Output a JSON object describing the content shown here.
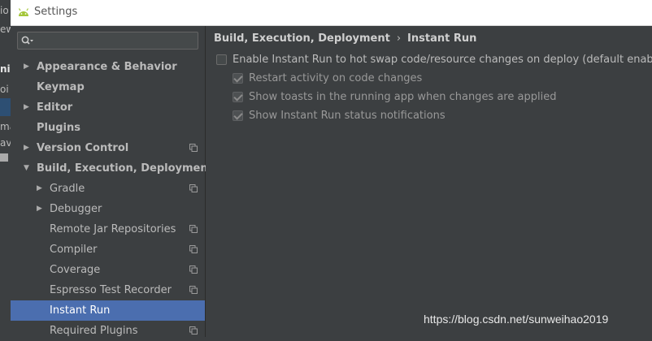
{
  "background_fragments": [
    "io",
    "ew",
    "ni",
    "oi",
    "ma",
    "av"
  ],
  "window": {
    "title": "Settings"
  },
  "sidebar": {
    "search_placeholder": "",
    "items": [
      {
        "label": "Appearance & Behavior",
        "arrow": "right",
        "bold": true
      },
      {
        "label": "Keymap",
        "arrow": "",
        "bold": true
      },
      {
        "label": "Editor",
        "arrow": "right",
        "bold": true
      },
      {
        "label": "Plugins",
        "arrow": "",
        "bold": true
      },
      {
        "label": "Version Control",
        "arrow": "right",
        "bold": true,
        "copy_icon": true
      },
      {
        "label": "Build, Execution, Deployment",
        "arrow": "down",
        "bold": true
      },
      {
        "label": "Gradle",
        "arrow": "right",
        "copy_icon": true
      },
      {
        "label": "Debugger",
        "arrow": "right"
      },
      {
        "label": "Remote Jar Repositories",
        "copy_icon": true
      },
      {
        "label": "Compiler",
        "copy_icon": true
      },
      {
        "label": "Coverage",
        "copy_icon": true
      },
      {
        "label": "Espresso Test Recorder",
        "copy_icon": true
      },
      {
        "label": "Instant Run",
        "selected": true
      },
      {
        "label": "Required Plugins",
        "copy_icon": true
      }
    ]
  },
  "content": {
    "breadcrumb": {
      "parent": "Build, Execution, Deployment",
      "separator": "›",
      "current": "Instant Run"
    },
    "options": {
      "enable": {
        "label": "Enable Instant Run to hot swap code/resource changes on deploy (default enabled)",
        "checked": false
      },
      "restart": {
        "label": "Restart activity on code changes",
        "checked": true
      },
      "toasts": {
        "label": "Show toasts in the running app when changes are applied",
        "checked": true
      },
      "notifications": {
        "label": "Show Instant Run status notifications",
        "checked": true
      }
    }
  },
  "watermark": "https://blog.csdn.net/sunweihao2019",
  "colors": {
    "background": "#3c3f41",
    "selection": "#4b6eaf",
    "android_green": "#a4c639"
  }
}
